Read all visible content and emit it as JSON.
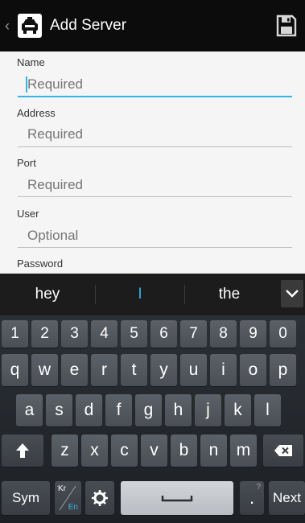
{
  "app_bar": {
    "title": "Add Server",
    "back_icon": "chevron-left-icon",
    "app_icon": "police-car-icon",
    "save_icon": "floppy-disk-icon"
  },
  "form": {
    "fields": [
      {
        "label": "Name",
        "placeholder": "Required",
        "focused": true
      },
      {
        "label": "Address",
        "placeholder": "Required",
        "focused": false
      },
      {
        "label": "Port",
        "placeholder": "Required",
        "focused": false
      },
      {
        "label": "User",
        "placeholder": "Optional",
        "focused": false
      },
      {
        "label": "Password"
      }
    ]
  },
  "suggestions": {
    "left": "hey",
    "middle": "I",
    "right": "the",
    "expand_icon": "chevron-down-icon"
  },
  "keyboard": {
    "row_numbers": [
      "1",
      "2",
      "3",
      "4",
      "5",
      "6",
      "7",
      "8",
      "9",
      "0"
    ],
    "row_top": [
      "q",
      "w",
      "e",
      "r",
      "t",
      "y",
      "u",
      "i",
      "o",
      "p"
    ],
    "row_mid": [
      "a",
      "s",
      "d",
      "f",
      "g",
      "h",
      "j",
      "k",
      "l"
    ],
    "row_bottom": [
      "z",
      "x",
      "c",
      "v",
      "b",
      "n",
      "m"
    ],
    "sym_label": "Sym",
    "lang_top": "Kr",
    "lang_bottom": "En",
    "period_label": ".",
    "period_hint": "?",
    "next_label": "Next",
    "shift_icon": "shift-arrow-icon",
    "backspace_icon": "backspace-icon",
    "settings_icon": "gear-icon",
    "space_icon": "space-bar-icon"
  },
  "colors": {
    "accent": "#33b5e5",
    "app_bar": "#0c0c0c",
    "keyboard_bg": "#24282d"
  }
}
